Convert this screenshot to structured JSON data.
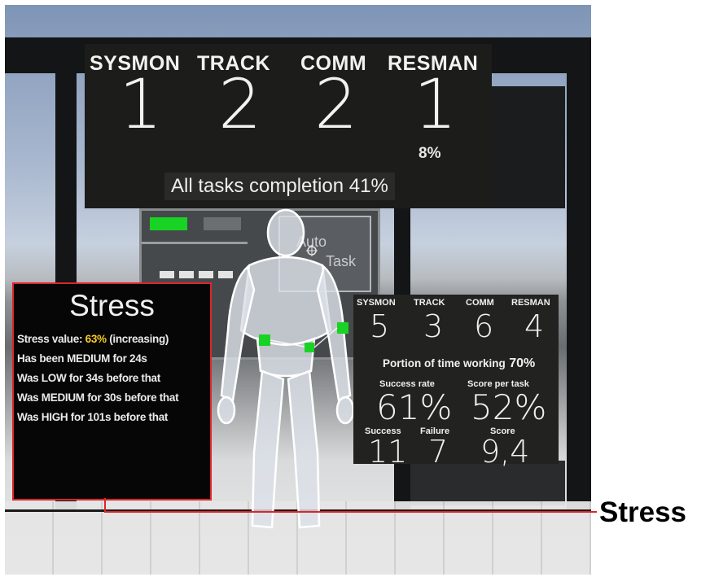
{
  "top_board": {
    "tasks": [
      {
        "label": "SYSMON",
        "count": "1"
      },
      {
        "label": "TRACK",
        "count": "2"
      },
      {
        "label": "COMM",
        "count": "2"
      },
      {
        "label": "RESMAN",
        "count": "1"
      }
    ],
    "resman_percent": "8%",
    "completion_label": "All tasks completion",
    "completion_value": "41%"
  },
  "background_screen": {
    "auto_label": "Auto",
    "task_label": "Task",
    "light_on_color": "#19d324",
    "light_off_color": "#6b6f72"
  },
  "stress_panel": {
    "title": "Stress",
    "value_prefix": "Stress value:",
    "value": "63%",
    "value_suffix": "(increasing)",
    "history": [
      "Has been MEDIUM for 24s",
      "Was LOW for 34s before that",
      "Was MEDIUM for 30s before that",
      "Was HIGH for 101s before that"
    ],
    "highlight_color": "#f5cd1e",
    "border_color": "#e0242a"
  },
  "stats_panel": {
    "tasks": [
      {
        "label": "SYSMON",
        "count": "5"
      },
      {
        "label": "TRACK",
        "count": "3"
      },
      {
        "label": "COMM",
        "count": "6"
      },
      {
        "label": "RESMAN",
        "count": "4"
      }
    ],
    "portion_label": "Portion of time working",
    "portion_value": "70%",
    "success_rate_label": "Success rate",
    "success_rate_value": "61%",
    "score_per_task_label": "Score per task",
    "score_per_task_value": "52%",
    "success_label": "Success",
    "success_value": "11",
    "failure_label": "Failure",
    "failure_value": "7",
    "score_label": "Score",
    "score_value": "9,4"
  },
  "callout": {
    "label": "Stress",
    "color": "#e0242a"
  }
}
